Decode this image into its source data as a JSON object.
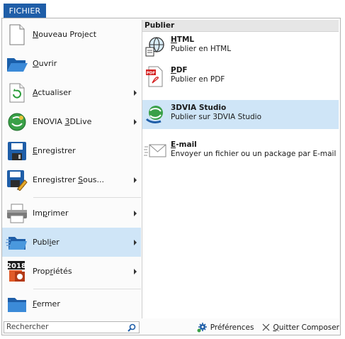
{
  "tab": {
    "label": "FICHIER"
  },
  "menu": {
    "items": [
      {
        "label_pre": "",
        "label_key": "N",
        "label_post": "ouveau Project",
        "icon": "new-document-icon",
        "submenu": false,
        "selected": false
      },
      {
        "label_pre": "",
        "label_key": "O",
        "label_post": "uvrir",
        "icon": "open-folder-icon",
        "submenu": false,
        "selected": false
      },
      {
        "label_pre": "",
        "label_key": "A",
        "label_post": "ctualiser",
        "icon": "refresh-icon",
        "submenu": true,
        "selected": false
      },
      {
        "label_pre": "ENOVIA ",
        "label_key": "3",
        "label_post": "DLive",
        "icon": "enovia-3dlive-icon",
        "submenu": true,
        "selected": false
      },
      {
        "label_pre": "",
        "label_key": "E",
        "label_post": "nregistrer",
        "icon": "save-icon",
        "submenu": false,
        "selected": false
      },
      {
        "label_pre": "Enregistrer ",
        "label_key": "S",
        "label_post": "ous...",
        "icon": "save-as-icon",
        "submenu": true,
        "selected": false
      },
      {
        "label_pre": "Im",
        "label_key": "p",
        "label_post": "rimer",
        "icon": "printer-icon",
        "submenu": true,
        "selected": false
      },
      {
        "label_pre": "Publ",
        "label_key": "i",
        "label_post": "er",
        "icon": "publish-folder-icon",
        "submenu": true,
        "selected": true
      },
      {
        "label_pre": "Prop",
        "label_key": "r",
        "label_post": "iétés",
        "icon": "properties-icon",
        "submenu": true,
        "selected": false
      },
      {
        "label_pre": "",
        "label_key": "F",
        "label_post": "ermer",
        "icon": "close-folder-icon",
        "submenu": false,
        "selected": false
      }
    ],
    "properties_icon_year": "2018"
  },
  "submenu": {
    "header": "Publier",
    "items": [
      {
        "title_key": "H",
        "title_rest": "TML",
        "desc": "Publier en HTML",
        "icon": "html-globe-icon",
        "selected": false
      },
      {
        "title_key": "P",
        "title_rest": "DF",
        "desc": "Publier en PDF",
        "icon": "pdf-icon",
        "selected": false
      },
      {
        "title_key": "",
        "title_rest": "3DVIA Studio",
        "desc": "Publier sur 3DVIA Studio",
        "icon": "3dvia-studio-icon",
        "selected": true
      },
      {
        "title_key": "E",
        "title_rest": "-mail",
        "desc": "Envoyer un fichier ou un package par E-mail",
        "icon": "email-icon",
        "selected": false
      }
    ],
    "pdf_icon_text": "PDF"
  },
  "footer": {
    "search_placeholder": "Rechercher",
    "preferences_label": "Préférences",
    "quit_key": "Q",
    "quit_rest": "uitter Composer"
  },
  "colors": {
    "accent": "#1f5ea8",
    "selection": "#cfe5f7"
  }
}
